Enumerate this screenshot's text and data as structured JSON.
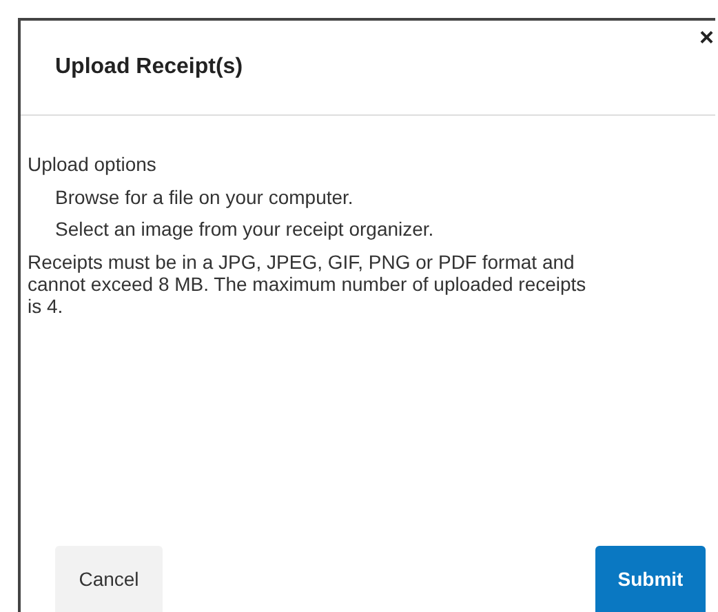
{
  "dialog": {
    "title": "Upload Receipt(s)",
    "close": "×"
  },
  "options_label": "Upload options",
  "options": [
    "Browse for a file on your computer.",
    "Select an image from your receipt organizer."
  ],
  "note": "Receipts must be in a JPG, JPEG, GIF, PNG or PDF format and cannot exceed 8 MB. The maximum number of uploaded receipts is 4.",
  "buttons": [
    {
      "label": "Cancel",
      "kind": "secondary"
    },
    {
      "label": "Submit",
      "kind": "primary"
    }
  ]
}
